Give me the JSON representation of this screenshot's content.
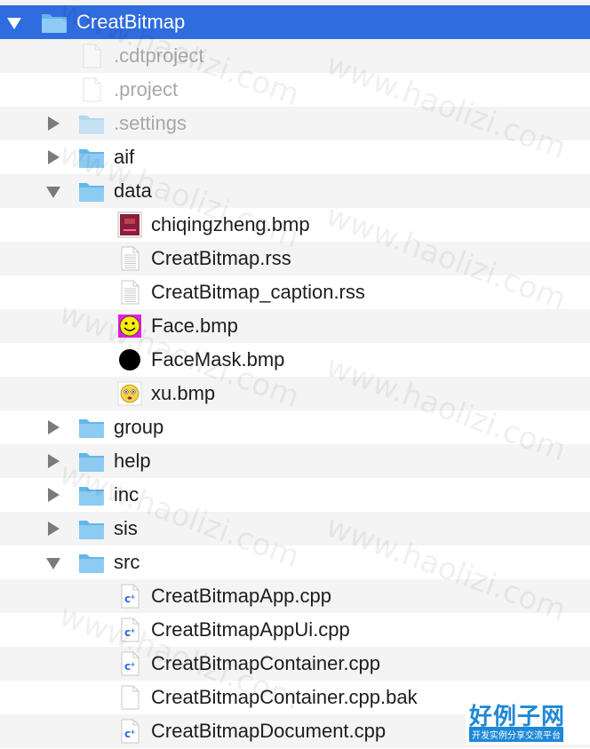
{
  "tree": [
    {
      "label": "CreatBitmap",
      "type": "folder",
      "expanded": true,
      "selected": true,
      "level": 0,
      "dim": false
    },
    {
      "label": ".cdtproject",
      "type": "file-blank",
      "level": 1,
      "dim": true
    },
    {
      "label": ".project",
      "type": "file-blank",
      "level": 1,
      "dim": true
    },
    {
      "label": ".settings",
      "type": "folder",
      "expanded": false,
      "level": 1,
      "dim": true
    },
    {
      "label": "aif",
      "type": "folder",
      "expanded": false,
      "level": 1,
      "dim": false
    },
    {
      "label": "data",
      "type": "folder",
      "expanded": true,
      "level": 1,
      "dim": false
    },
    {
      "label": "chiqingzheng.bmp",
      "type": "image-red",
      "level": 2,
      "dim": false
    },
    {
      "label": "CreatBitmap.rss",
      "type": "file-text",
      "level": 2,
      "dim": false
    },
    {
      "label": "CreatBitmap_caption.rss",
      "type": "file-text",
      "level": 2,
      "dim": false
    },
    {
      "label": "Face.bmp",
      "type": "image-face",
      "level": 2,
      "dim": false
    },
    {
      "label": "FaceMask.bmp",
      "type": "image-mask",
      "level": 2,
      "dim": false
    },
    {
      "label": "xu.bmp",
      "type": "image-xu",
      "level": 2,
      "dim": false
    },
    {
      "label": "group",
      "type": "folder",
      "expanded": false,
      "level": 1,
      "dim": false
    },
    {
      "label": "help",
      "type": "folder",
      "expanded": false,
      "level": 1,
      "dim": false
    },
    {
      "label": "inc",
      "type": "folder",
      "expanded": false,
      "level": 1,
      "dim": false
    },
    {
      "label": "sis",
      "type": "folder",
      "expanded": false,
      "level": 1,
      "dim": false
    },
    {
      "label": "src",
      "type": "folder",
      "expanded": true,
      "level": 1,
      "dim": false
    },
    {
      "label": "CreatBitmapApp.cpp",
      "type": "file-cpp",
      "level": 2,
      "dim": false
    },
    {
      "label": "CreatBitmapAppUi.cpp",
      "type": "file-cpp",
      "level": 2,
      "dim": false
    },
    {
      "label": "CreatBitmapContainer.cpp",
      "type": "file-cpp",
      "level": 2,
      "dim": false
    },
    {
      "label": "CreatBitmapContainer.cpp.bak",
      "type": "file-blank",
      "level": 2,
      "dim": false
    },
    {
      "label": "CreatBitmapDocument.cpp",
      "type": "file-cpp",
      "level": 2,
      "dim": false
    }
  ],
  "watermark": {
    "text": "www.haolizi.com",
    "logo": "好例子网",
    "logo_tagline": "开发实例分享交流平台"
  },
  "colors": {
    "selection": "#2f6ce0",
    "folder": "#63b6ea",
    "stripe": "#f4f4f4"
  }
}
